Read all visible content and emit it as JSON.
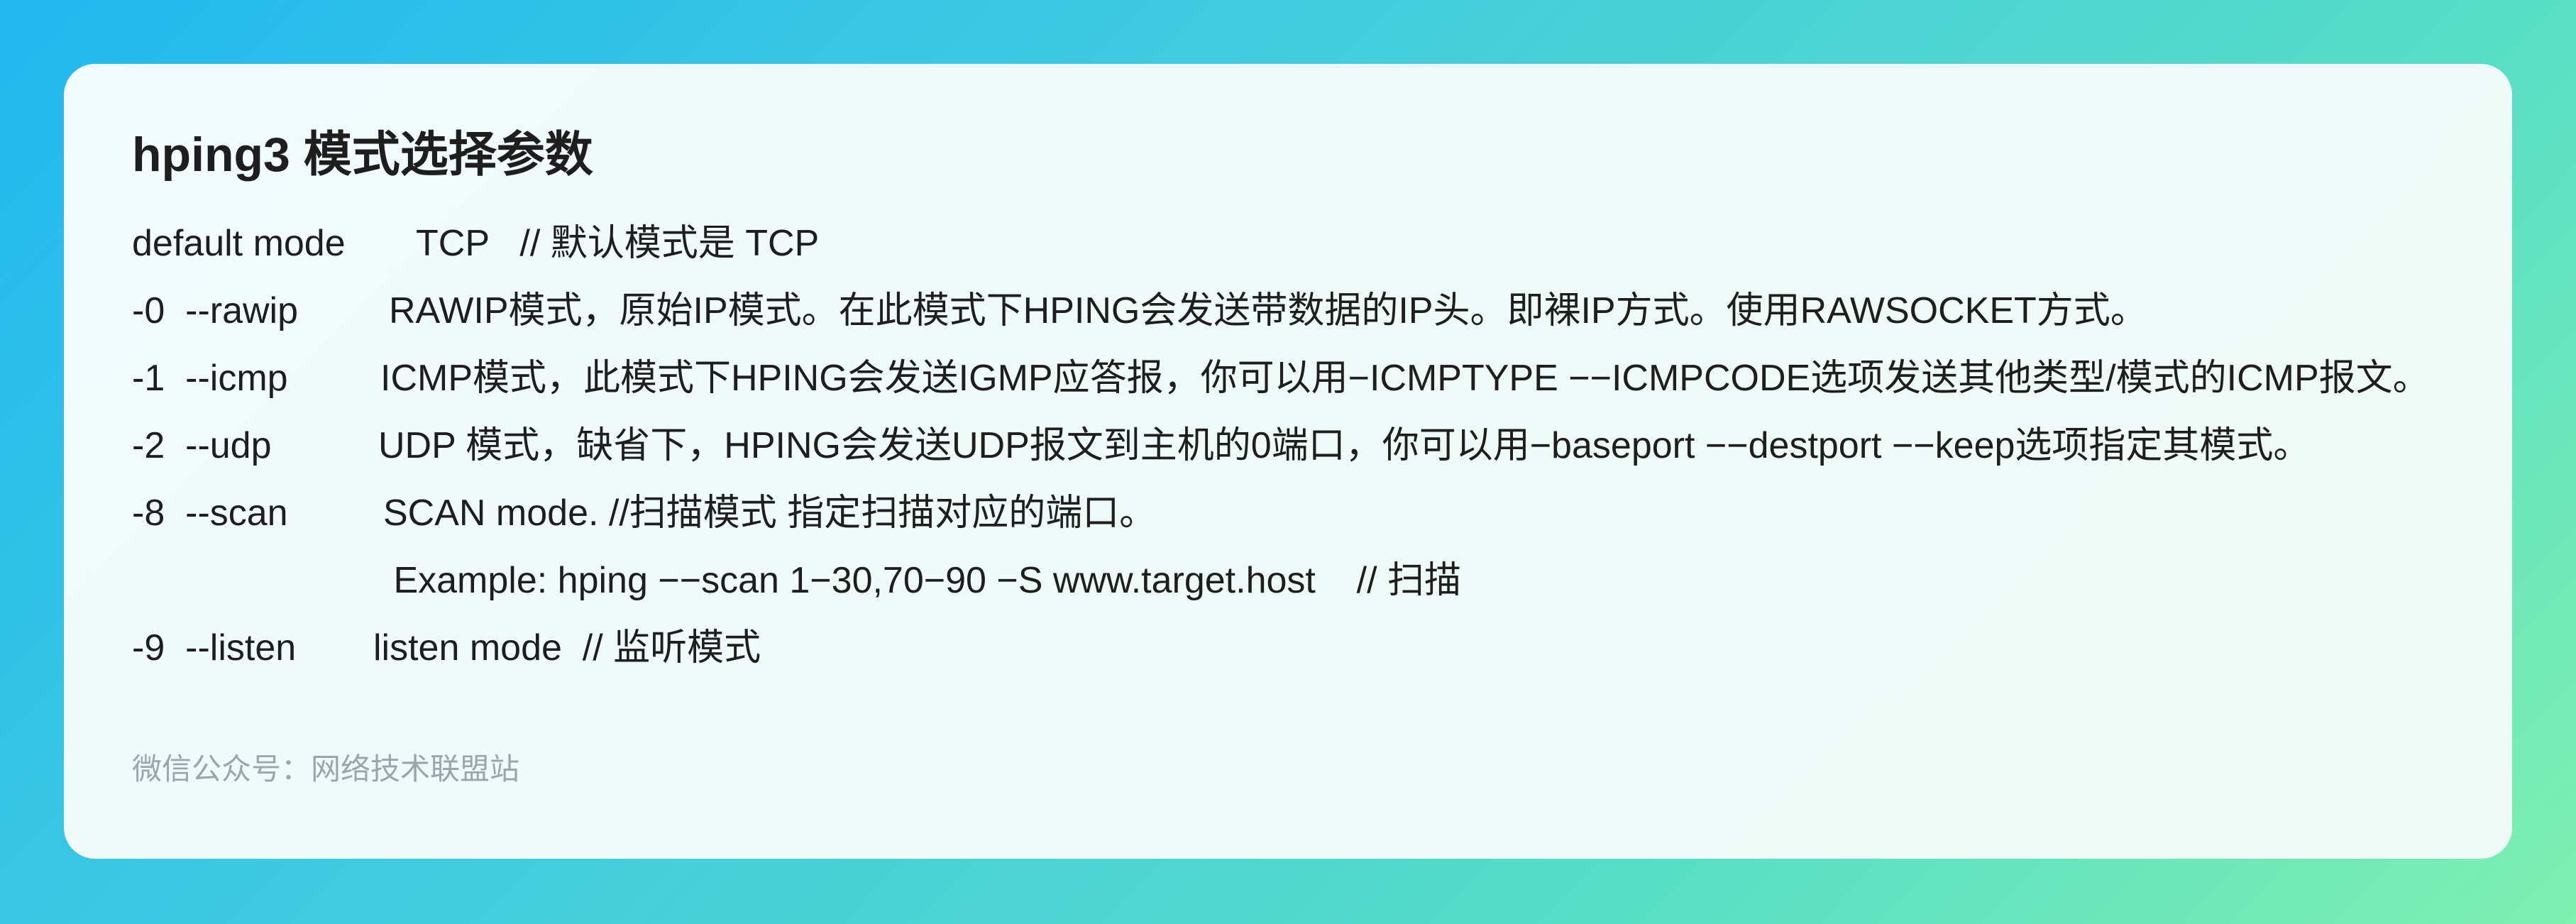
{
  "title": "hping3 模式选择参数",
  "rows": [
    {
      "option": "default mode",
      "desc": "TCP   // 默认模式是 TCP"
    },
    {
      "option": "-0  --rawip",
      "desc": "RAWIP模式，原始IP模式。在此模式下HPING会发送带数据的IP头。即裸IP方式。使用RAWSOCKET方式。"
    },
    {
      "option": "-1  --icmp",
      "desc": "ICMP模式，此模式下HPING会发送IGMP应答报，你可以用−ICMPTYPE −−ICMPCODE选项发送其他类型/模式的ICMP报文。"
    },
    {
      "option": "-2  --udp",
      "desc": "UDP 模式，缺省下，HPING会发送UDP报文到主机的0端口，你可以用−baseport −−destport −−keep选项指定其模式。"
    },
    {
      "option": "-8  --scan",
      "desc": "SCAN mode. //扫描模式 指定扫描对应的端口。"
    },
    {
      "option": "",
      "desc": " Example: hping −−scan 1−30,70−90 −S www.target.host    // 扫描"
    },
    {
      "option": "-9  --listen",
      "desc": "listen mode  // 监听模式"
    }
  ],
  "footer": "微信公众号：网络技术联盟站"
}
